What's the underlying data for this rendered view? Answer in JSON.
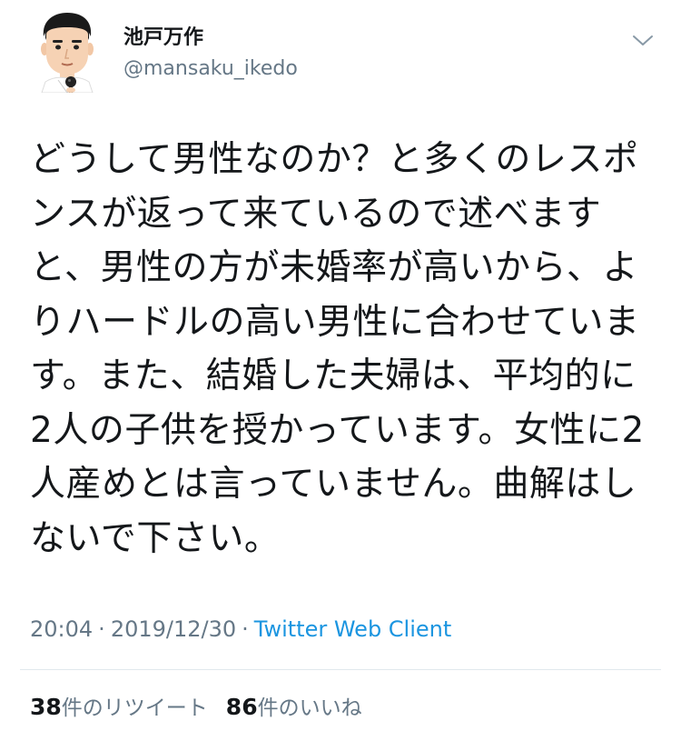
{
  "user": {
    "display_name": "池戸万作",
    "screen_name": "@mansaku_ikedo"
  },
  "tweet": {
    "lines": [
      "どうして男性なのか？と多くのレスポ",
      "ンスが返って来ているので述べます",
      "と、男性の方が未婚率が高いから、よ",
      "りハードルの高い男性に合わせていま",
      "す。また、結婚した夫婦は、平均的に",
      "2人の子供を授かっています。女性に2",
      "人産めとは言っていません。曲解はし",
      "ないで下さい。"
    ]
  },
  "meta": {
    "time": "20:04",
    "separator": "·",
    "date": "2019/12/30",
    "client": "Twitter Web Client"
  },
  "stats": {
    "retweet_count": "38",
    "retweet_label": "件のリツイート",
    "like_count": "86",
    "like_label": "件のいいね"
  },
  "colors": {
    "text_primary": "#14171a",
    "text_secondary": "#657786",
    "link": "#1b95e0",
    "divider": "#e1e8ed"
  },
  "icons": {
    "more": "chevron-down-icon",
    "avatar": "avatar"
  }
}
